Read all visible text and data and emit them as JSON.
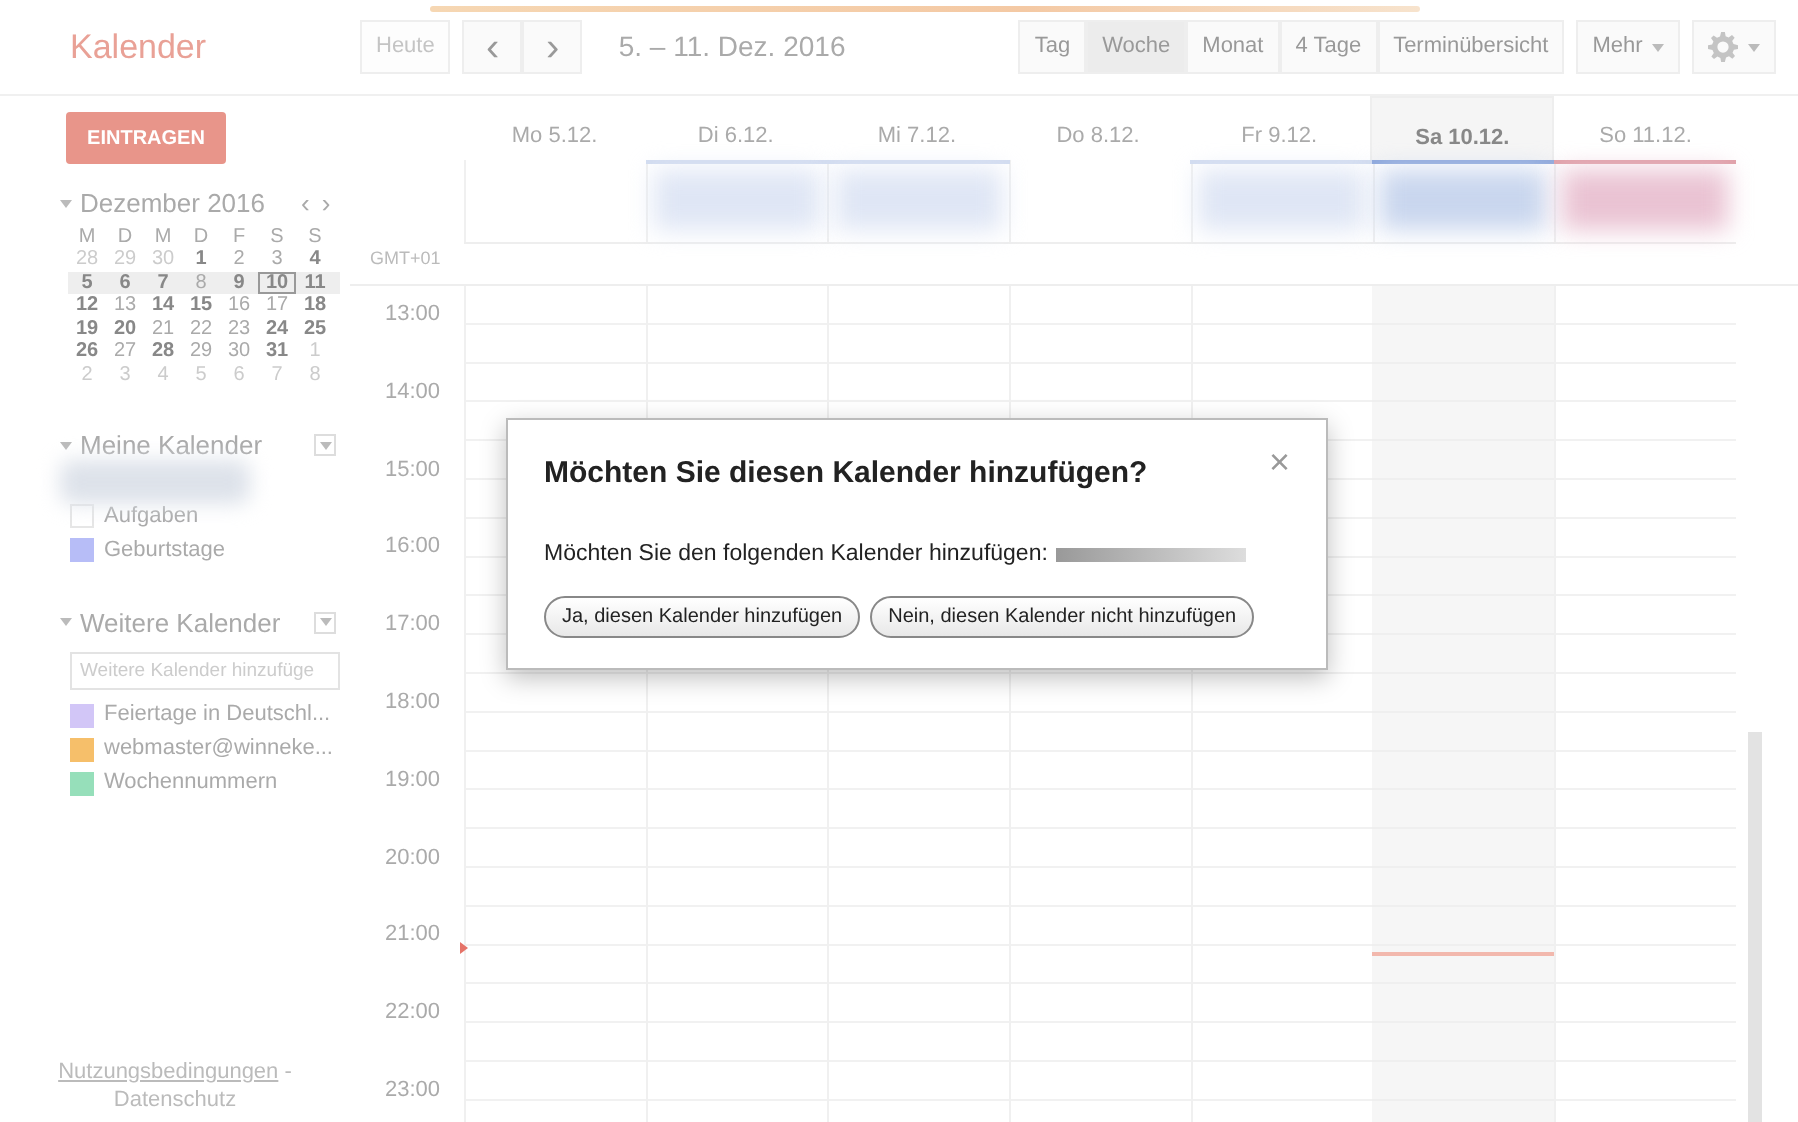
{
  "app_title": "Kalender",
  "toolbar": {
    "today": {
      "label": "Heute",
      "disabled": true
    },
    "prev": "‹",
    "next": "›",
    "range": "5. – 11. Dez. 2016",
    "views": [
      {
        "label": "Tag",
        "selected": false
      },
      {
        "label": "Woche",
        "selected": true
      },
      {
        "label": "Monat",
        "selected": false
      },
      {
        "label": "4 Tage",
        "selected": false
      },
      {
        "label": "Terminübersicht",
        "selected": false
      }
    ],
    "more": "Mehr"
  },
  "create_button": "EINTRAGEN",
  "mini_calendar": {
    "title": "Dezember 2016",
    "prev": "‹",
    "next": "›",
    "expanded": true,
    "weekdays": [
      "M",
      "D",
      "M",
      "D",
      "F",
      "S",
      "S"
    ],
    "weeks": [
      {
        "selected": false,
        "days": [
          {
            "d": "28",
            "kind": "muted"
          },
          {
            "d": "29",
            "kind": "muted"
          },
          {
            "d": "30",
            "kind": "muted"
          },
          {
            "d": "1",
            "kind": "bold"
          },
          {
            "d": "2",
            "kind": "normal"
          },
          {
            "d": "3",
            "kind": "normal"
          },
          {
            "d": "4",
            "kind": "bold"
          }
        ]
      },
      {
        "selected": true,
        "days": [
          {
            "d": "5",
            "kind": "bold"
          },
          {
            "d": "6",
            "kind": "bold"
          },
          {
            "d": "7",
            "kind": "bold"
          },
          {
            "d": "8",
            "kind": "normal"
          },
          {
            "d": "9",
            "kind": "bold"
          },
          {
            "d": "10",
            "kind": "bold",
            "today": true
          },
          {
            "d": "11",
            "kind": "bold"
          }
        ]
      },
      {
        "selected": false,
        "days": [
          {
            "d": "12",
            "kind": "bold"
          },
          {
            "d": "13",
            "kind": "normal"
          },
          {
            "d": "14",
            "kind": "bold"
          },
          {
            "d": "15",
            "kind": "bold"
          },
          {
            "d": "16",
            "kind": "normal"
          },
          {
            "d": "17",
            "kind": "normal"
          },
          {
            "d": "18",
            "kind": "bold"
          }
        ]
      },
      {
        "selected": false,
        "days": [
          {
            "d": "19",
            "kind": "bold"
          },
          {
            "d": "20",
            "kind": "bold"
          },
          {
            "d": "21",
            "kind": "normal"
          },
          {
            "d": "22",
            "kind": "normal"
          },
          {
            "d": "23",
            "kind": "normal"
          },
          {
            "d": "24",
            "kind": "bold"
          },
          {
            "d": "25",
            "kind": "bold"
          }
        ]
      },
      {
        "selected": false,
        "days": [
          {
            "d": "26",
            "kind": "bold"
          },
          {
            "d": "27",
            "kind": "normal"
          },
          {
            "d": "28",
            "kind": "bold"
          },
          {
            "d": "29",
            "kind": "normal"
          },
          {
            "d": "30",
            "kind": "normal"
          },
          {
            "d": "31",
            "kind": "bold"
          },
          {
            "d": "1",
            "kind": "muted"
          }
        ]
      },
      {
        "selected": false,
        "days": [
          {
            "d": "2",
            "kind": "muted"
          },
          {
            "d": "3",
            "kind": "muted"
          },
          {
            "d": "4",
            "kind": "muted"
          },
          {
            "d": "5",
            "kind": "muted"
          },
          {
            "d": "6",
            "kind": "muted"
          },
          {
            "d": "7",
            "kind": "muted"
          },
          {
            "d": "8",
            "kind": "muted"
          }
        ]
      }
    ]
  },
  "calendar_groups": [
    {
      "title": "Meine Kalender",
      "expanded": true,
      "items": [
        {
          "kind": "redacted"
        },
        {
          "kind": "calendar",
          "label": "Aufgaben",
          "checked": false
        },
        {
          "kind": "calendar",
          "label": "Geburtstage",
          "checked": true,
          "color": "#b7bdf7"
        }
      ]
    },
    {
      "title": "Weitere Kalender",
      "expanded": true,
      "search": {
        "placeholder": "Weitere Kalender hinzufüge"
      },
      "items": [
        {
          "kind": "calendar",
          "label": "Feiertage in Deutschl...",
          "checked": true,
          "color": "#d2c6f7"
        },
        {
          "kind": "calendar",
          "label": "webmaster@winneke...",
          "checked": true,
          "color": "#f6bf6a"
        },
        {
          "kind": "calendar",
          "label": "Wochennummern",
          "checked": true,
          "color": "#96dfba"
        }
      ]
    }
  ],
  "footer": {
    "terms": "Nutzungsbedingungen",
    "separator": "-",
    "privacy": "Datenschutz"
  },
  "week": {
    "timezone": "GMT+01",
    "days": [
      {
        "label": "Mo 5.12.",
        "today": false
      },
      {
        "label": "Di 6.12.",
        "today": false,
        "color": "#dfe6f5"
      },
      {
        "label": "Mi 7.12.",
        "today": false,
        "color": "#dfe6f5"
      },
      {
        "label": "Do 8.12.",
        "today": false
      },
      {
        "label": "Fr 9.12.",
        "today": false,
        "color": "#dfe6f5"
      },
      {
        "label": "Sa 10.12.",
        "today": true,
        "color": "#c9d6ee"
      },
      {
        "label": "So 11.12.",
        "today": false,
        "color": "#eac3d3"
      }
    ],
    "hours": [
      "13:00",
      "14:00",
      "15:00",
      "16:00",
      "17:00",
      "18:00",
      "19:00",
      "20:00",
      "21:00",
      "22:00",
      "23:00"
    ]
  },
  "dialog": {
    "title": "Möchten Sie diesen Kalender hinzufügen?",
    "close": "×",
    "message": "Möchten Sie den folgenden Kalender hinzufügen:",
    "buttons": [
      "Ja, diesen Kalender hinzufügen",
      "Nein, diesen Kalender nicht hinzufügen"
    ]
  }
}
